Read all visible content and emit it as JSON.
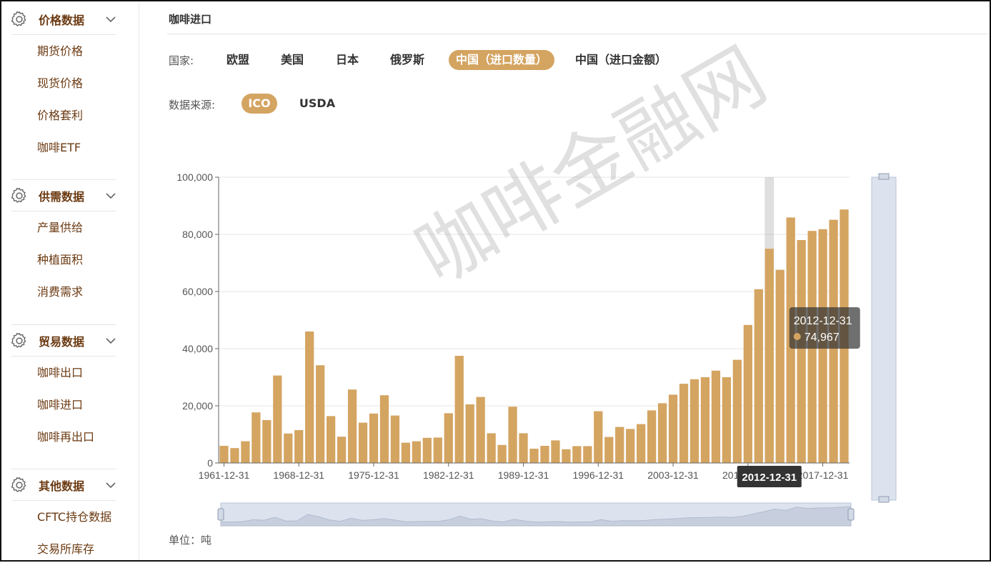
{
  "sidebar": {
    "groups": [
      {
        "title": "价格数据",
        "items": [
          "期货价格",
          "现货价格",
          "价格套利",
          "咖啡ETF"
        ]
      },
      {
        "title": "供需数据",
        "items": [
          "产量供给",
          "种植面积",
          "消费需求"
        ]
      },
      {
        "title": "贸易数据",
        "items": [
          "咖啡出口",
          "咖啡进口",
          "咖啡再出口"
        ]
      },
      {
        "title": "其他数据",
        "items": [
          "CFTC持仓数据",
          "交易所库存"
        ]
      }
    ]
  },
  "main": {
    "title": "咖啡进口",
    "country_label": "国家:",
    "countries": [
      "欧盟",
      "美国",
      "日本",
      "俄罗斯",
      "中国（进口数量）",
      "中国（进口金额）"
    ],
    "active_country": "中国（进口数量）",
    "source_label": "数据来源:",
    "sources": [
      "ICO",
      "USDA"
    ],
    "active_source": "ICO",
    "unit_label": "单位：吨",
    "watermark": "咖啡金融网"
  },
  "colors": {
    "bar": "#d4a461",
    "accent": "#d4a461",
    "sidebar_text": "#6b3a12",
    "tooltip_bg": "rgba(50,50,50,0.7)",
    "axis_tip_bg": "#333333",
    "slider": "#dde3ee"
  },
  "chart_data": {
    "type": "bar",
    "x": [
      "1961-12-31",
      "1962-12-31",
      "1963-12-31",
      "1964-12-31",
      "1965-12-31",
      "1966-12-31",
      "1967-12-31",
      "1968-12-31",
      "1969-12-31",
      "1970-12-31",
      "1971-12-31",
      "1972-12-31",
      "1973-12-31",
      "1974-12-31",
      "1975-12-31",
      "1976-12-31",
      "1977-12-31",
      "1978-12-31",
      "1979-12-31",
      "1980-12-31",
      "1981-12-31",
      "1982-12-31",
      "1983-12-31",
      "1984-12-31",
      "1985-12-31",
      "1986-12-31",
      "1987-12-31",
      "1988-12-31",
      "1989-12-31",
      "1990-12-31",
      "1991-12-31",
      "1992-12-31",
      "1993-12-31",
      "1994-12-31",
      "1995-12-31",
      "1996-12-31",
      "1997-12-31",
      "1998-12-31",
      "1999-12-31",
      "2000-12-31",
      "2001-12-31",
      "2002-12-31",
      "2003-12-31",
      "2004-12-31",
      "2005-12-31",
      "2006-12-31",
      "2007-12-31",
      "2008-12-31",
      "2009-12-31",
      "2010-12-31",
      "2011-12-31",
      "2012-12-31",
      "2013-12-31",
      "2014-12-31",
      "2015-12-31",
      "2016-12-31",
      "2017-12-31",
      "2018-12-31",
      "2019-12-31"
    ],
    "values": [
      6000,
      5200,
      7600,
      17700,
      15000,
      30600,
      10300,
      11500,
      46000,
      34200,
      16400,
      9200,
      25700,
      14100,
      17300,
      23700,
      16600,
      7100,
      7600,
      8800,
      8900,
      17400,
      37500,
      20500,
      23100,
      10400,
      6300,
      19700,
      10400,
      5000,
      6000,
      7900,
      4800,
      5900,
      5900,
      18100,
      9100,
      12600,
      11900,
      13600,
      18400,
      20900,
      23900,
      27700,
      29300,
      30000,
      32300,
      30000,
      36100,
      48300,
      60800,
      74967,
      67600,
      85900,
      78000,
      81200,
      81800,
      85100,
      88700
    ],
    "ylim": [
      0,
      100000
    ],
    "yticks": [
      "100,000",
      "80,000",
      "60,000",
      "40,000",
      "20,000",
      "0"
    ],
    "xtick_labels": [
      "1961-12-31",
      "1968-12-31",
      "1975-12-31",
      "1982-12-31",
      "1989-12-31",
      "1996-12-31",
      "2003-12-31",
      "2010-12-31",
      "2017-12-31"
    ],
    "grid": true,
    "highlight": {
      "date": "2012-12-31",
      "value": "74,967"
    }
  }
}
